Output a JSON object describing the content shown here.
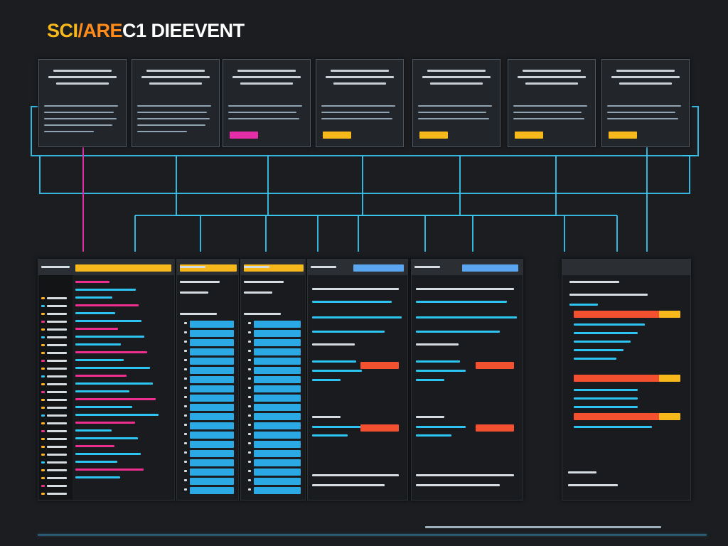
{
  "title": {
    "part1": "SCI",
    "part2": "/ARE",
    "part3": "C1 DIEEVENT"
  },
  "colors": {
    "background": "#1b1d21",
    "connector": "#39c6ef",
    "accent_yellow": "#f7b81b",
    "accent_orange": "#ff8c1a",
    "accent_magenta": "#e42ea8",
    "accent_red": "#f2502e",
    "accent_blue": "#5aa6f0"
  },
  "cards": [
    {
      "tag_color": ""
    },
    {
      "tag_color": ""
    },
    {
      "tag_color": "#e42ea8"
    },
    {
      "tag_color": "#f7b81b"
    },
    {
      "tag_color": "#f7b81b"
    },
    {
      "tag_color": "#f7b81b"
    },
    {
      "tag_color": "#f7b81b"
    }
  ],
  "panels": [
    {
      "header_color": "#f7b81b",
      "role": "nav-list-panel"
    },
    {
      "header_color": "#f7b81b",
      "role": "item-list-panel"
    },
    {
      "header_color": "#f7b81b",
      "role": "item-list-panel"
    },
    {
      "header_color": "#5aa6f0",
      "role": "form-panel"
    },
    {
      "header_color": "#5aa6f0",
      "role": "form-panel"
    },
    {
      "header_color": "#2b2f33",
      "role": "progress-panel"
    }
  ]
}
